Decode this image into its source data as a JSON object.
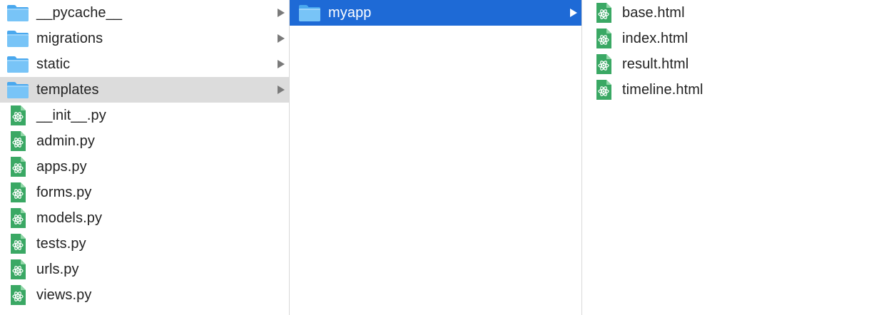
{
  "columns": [
    {
      "items": [
        {
          "label": "__pycache__",
          "kind": "folder",
          "icon": "folder-icon",
          "has_children": true
        },
        {
          "label": "migrations",
          "kind": "folder",
          "icon": "folder-icon",
          "has_children": true
        },
        {
          "label": "static",
          "kind": "folder",
          "icon": "folder-icon",
          "has_children": true
        },
        {
          "label": "templates",
          "kind": "folder",
          "icon": "folder-icon",
          "has_children": true,
          "state": "selected-inactive"
        },
        {
          "label": "__init__.py",
          "kind": "file",
          "icon": "atom-document-icon"
        },
        {
          "label": "admin.py",
          "kind": "file",
          "icon": "atom-document-icon"
        },
        {
          "label": "apps.py",
          "kind": "file",
          "icon": "atom-document-icon"
        },
        {
          "label": "forms.py",
          "kind": "file",
          "icon": "atom-document-icon"
        },
        {
          "label": "models.py",
          "kind": "file",
          "icon": "atom-document-icon"
        },
        {
          "label": "tests.py",
          "kind": "file",
          "icon": "atom-document-icon"
        },
        {
          "label": "urls.py",
          "kind": "file",
          "icon": "atom-document-icon"
        },
        {
          "label": "views.py",
          "kind": "file",
          "icon": "atom-document-icon"
        }
      ]
    },
    {
      "items": [
        {
          "label": "myapp",
          "kind": "folder",
          "icon": "folder-icon",
          "has_children": true,
          "state": "selected-active"
        }
      ]
    },
    {
      "items": [
        {
          "label": "base.html",
          "kind": "file",
          "icon": "atom-document-icon"
        },
        {
          "label": "index.html",
          "kind": "file",
          "icon": "atom-document-icon"
        },
        {
          "label": "result.html",
          "kind": "file",
          "icon": "atom-document-icon"
        },
        {
          "label": "timeline.html",
          "kind": "file",
          "icon": "atom-document-icon"
        }
      ]
    }
  ],
  "colors": {
    "selection_active": "#1e6ad6",
    "selection_inactive": "#dcdcdc",
    "folder_body": "#6cbdf5",
    "folder_tab": "#4aa8ee",
    "file_green": "#3aa864",
    "arrow": "#7a7a7a"
  }
}
